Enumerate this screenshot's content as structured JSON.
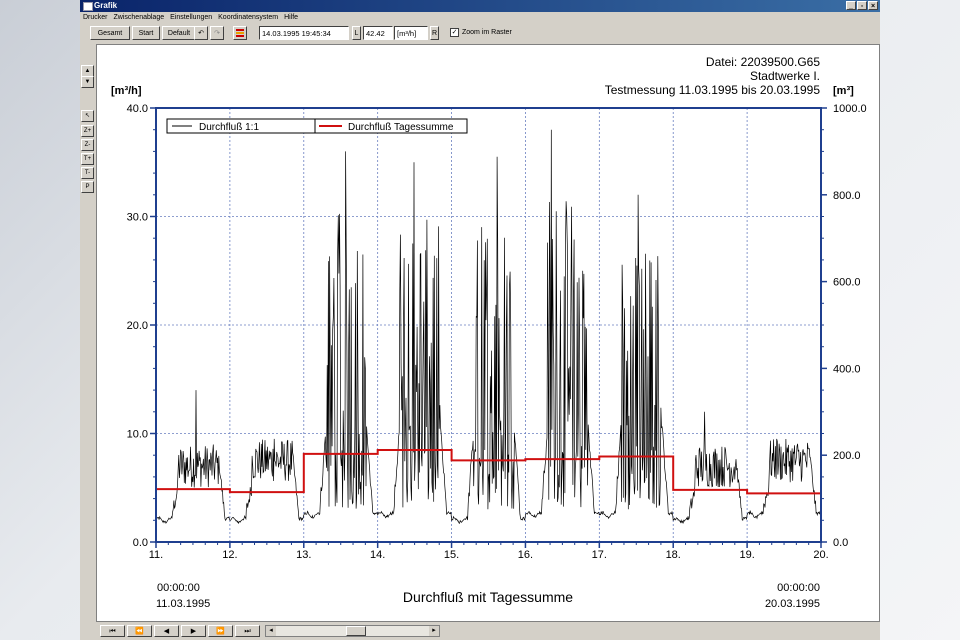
{
  "window": {
    "title": "Grafik"
  },
  "menu": [
    "Drucker",
    "Zwischenablage",
    "Einstellungen",
    "Koordinatensystem",
    "Hilfe"
  ],
  "toolbar": {
    "gesamt": "Gesamt",
    "start": "Start",
    "default": "Default",
    "undo_icon": "undo-icon",
    "redo_icon": "redo-icon",
    "color_icon": "color-bars-icon",
    "datetime": "14.03.1995 19:45:34",
    "l_label": "L",
    "value": "42.42",
    "unit": "[m³/h]",
    "r_label": "R",
    "zoom_checked": true,
    "zoom_label": "Zoom im Raster"
  },
  "sidebar": [
    "Z+",
    "Z-",
    "T+",
    "T-",
    "P"
  ],
  "header": {
    "file": "Datei: 22039500.G65",
    "company": "Stadtwerke I.",
    "period": "Testmessung 11.03.1995 bis 20.03.1995"
  },
  "chart_data": {
    "type": "line",
    "title": "Durchfluß mit Tagessumme",
    "y_left_label": "[m³/h]",
    "y_right_label": "[m³]",
    "ylim_left": [
      0,
      40
    ],
    "ylim_right": [
      0,
      1000
    ],
    "yticks_left": [
      "0.0",
      "10.0",
      "20.0",
      "30.0",
      "40.0"
    ],
    "yticks_right": [
      "0.0",
      "200.0",
      "400.0",
      "600.0",
      "800.0",
      "1000.0"
    ],
    "x_ticks": [
      "11.",
      "12.",
      "13.",
      "14.",
      "15.",
      "16.",
      "17.",
      "18.",
      "19.",
      "20."
    ],
    "x_start": {
      "time": "00:00:00",
      "date": "11.03.1995"
    },
    "x_end": {
      "time": "00:00:00",
      "date": "20.03.1995"
    },
    "grid": true,
    "legend_position": "top-left",
    "colors": {
      "flow": "#000000",
      "daily": "#d01010",
      "axis": "#1f3f8f"
    },
    "series": [
      {
        "name": "Durchfluß 1:1",
        "days": [
          {
            "day": 0,
            "base": 2.0,
            "peak_mean": 7.0,
            "peak_max": 14.0,
            "spiky": false
          },
          {
            "day": 1,
            "base": 2.0,
            "peak_mean": 7.5,
            "peak_max": 9.5,
            "spiky": false
          },
          {
            "day": 2,
            "base": 2.5,
            "peak_mean": 16.0,
            "peak_max": 36.0,
            "spiky": true
          },
          {
            "day": 3,
            "base": 2.5,
            "peak_mean": 17.0,
            "peak_max": 35.0,
            "spiky": true
          },
          {
            "day": 4,
            "base": 2.0,
            "peak_mean": 16.0,
            "peak_max": 35.5,
            "spiky": true
          },
          {
            "day": 5,
            "base": 2.5,
            "peak_mean": 16.5,
            "peak_max": 38.0,
            "spiky": true
          },
          {
            "day": 6,
            "base": 2.5,
            "peak_mean": 17.0,
            "peak_max": 32.0,
            "spiky": true
          },
          {
            "day": 7,
            "base": 2.0,
            "peak_mean": 7.0,
            "peak_max": 12.0,
            "spiky": false
          },
          {
            "day": 8,
            "base": 2.5,
            "peak_mean": 7.5,
            "peak_max": 9.5,
            "spiky": false
          }
        ]
      },
      {
        "name": "Durchfluß Tagessumme",
        "values_m3": [
          122,
          115,
          203,
          212,
          188,
          191,
          197,
          120,
          112
        ]
      }
    ]
  },
  "nav": [
    "⏮",
    "⏪",
    "◀",
    "▶",
    "⏩",
    "⏭"
  ]
}
